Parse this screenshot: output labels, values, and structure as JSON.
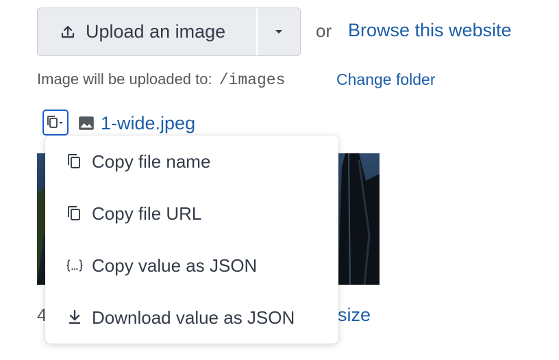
{
  "upload": {
    "button_label": "Upload an image",
    "or_text": "or",
    "browse_label": "Browse this website"
  },
  "location": {
    "prefix": "Image will be uploaded to:",
    "folder": "/images",
    "change_folder_label": "Change folder"
  },
  "file": {
    "name": "1-wide.jpeg"
  },
  "below": {
    "partial_left": "4",
    "partial_right": "esize"
  },
  "menu": {
    "items": [
      {
        "label": "Copy file name",
        "icon": "copy-icon"
      },
      {
        "label": "Copy file URL",
        "icon": "copy-icon"
      },
      {
        "label": "Copy value as JSON",
        "icon": "json-braces-icon"
      },
      {
        "label": "Download value as JSON",
        "icon": "download-icon"
      }
    ]
  },
  "colors": {
    "link": "#1c5ea8",
    "focus_ring": "#1a5fd0",
    "button_bg": "#eaecf0",
    "text": "#333c48"
  }
}
